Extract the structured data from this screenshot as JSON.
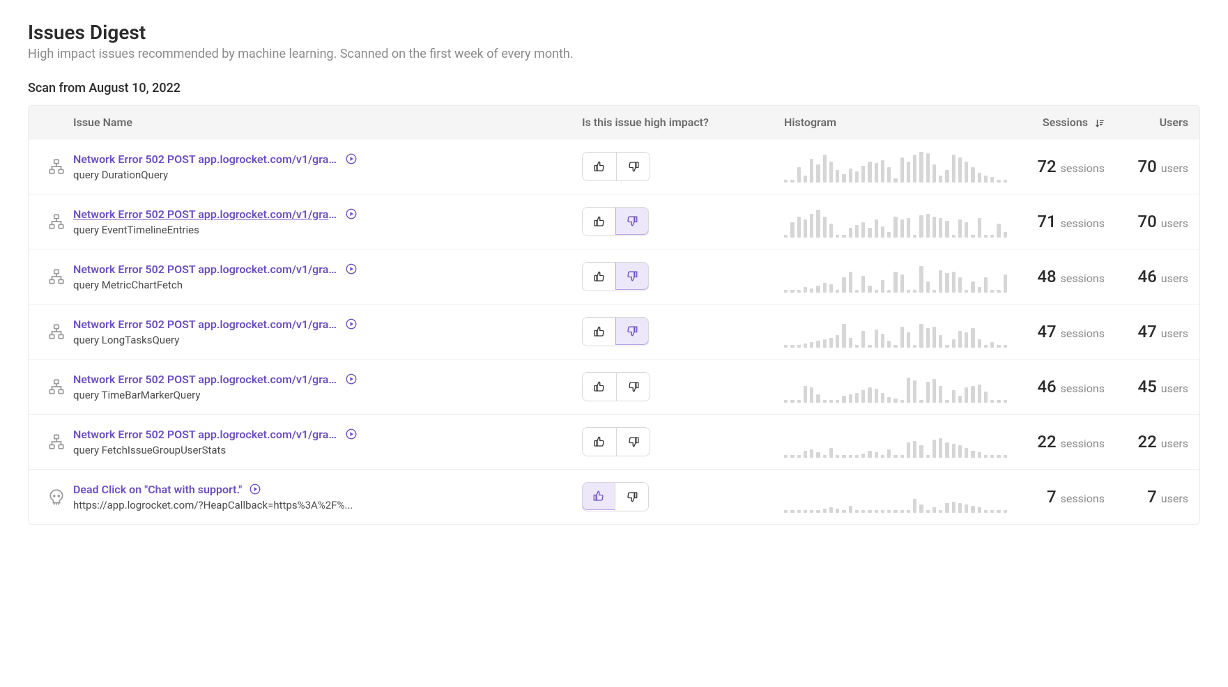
{
  "header": {
    "title": "Issues Digest",
    "subtitle": "High impact issues recommended by machine learning. Scanned on the first week of every month.",
    "scan_line": "Scan from August 10, 2022"
  },
  "columns": {
    "name": "Issue Name",
    "impact": "Is this issue high impact?",
    "histogram": "Histogram",
    "sessions": "Sessions",
    "users": "Users"
  },
  "labels": {
    "sessions_unit": "sessions",
    "users_unit": "users"
  },
  "rows": [
    {
      "icon": "network",
      "title_html": "Network Error 502 POST app.logrocket.com/v1/grap...",
      "underlined": false,
      "subtitle": "query DurationQuery",
      "vote": "none",
      "sessions": 72,
      "users": 70,
      "hist": [
        4,
        4,
        22,
        10,
        34,
        26,
        40,
        30,
        18,
        12,
        20,
        16,
        24,
        30,
        28,
        32,
        22,
        6,
        36,
        30,
        40,
        44,
        42,
        26,
        10,
        18,
        40,
        36,
        30,
        22,
        14,
        10,
        8,
        4,
        4
      ]
    },
    {
      "icon": "network",
      "title_html": "Network Error 502 POST app.logrocket.com/v1/grap...",
      "underlined": true,
      "subtitle": "query EventTimelineEntries",
      "vote": "down",
      "sessions": 71,
      "users": 70,
      "hist": [
        4,
        22,
        30,
        26,
        34,
        40,
        30,
        20,
        4,
        4,
        14,
        18,
        22,
        14,
        26,
        16,
        8,
        30,
        26,
        28,
        4,
        32,
        34,
        30,
        28,
        24,
        4,
        26,
        22,
        4,
        28,
        4,
        4,
        20,
        8
      ]
    },
    {
      "icon": "network",
      "title_html": "Network Error 502 POST app.logrocket.com/v1/grap...",
      "underlined": false,
      "subtitle": "query MetricChartFetch",
      "vote": "down",
      "sessions": 48,
      "users": 46,
      "hist": [
        4,
        4,
        4,
        8,
        6,
        10,
        14,
        12,
        4,
        22,
        30,
        4,
        24,
        10,
        4,
        18,
        4,
        30,
        26,
        4,
        4,
        38,
        16,
        4,
        32,
        28,
        30,
        22,
        4,
        16,
        8,
        22,
        4,
        4,
        26
      ]
    },
    {
      "icon": "network",
      "title_html": "Network Error 502 POST app.logrocket.com/v1/grap...",
      "underlined": false,
      "subtitle": "query LongTasksQuery",
      "vote": "down",
      "sessions": 47,
      "users": 47,
      "hist": [
        4,
        4,
        4,
        6,
        8,
        10,
        12,
        14,
        18,
        34,
        14,
        4,
        24,
        4,
        26,
        20,
        10,
        4,
        30,
        22,
        4,
        34,
        28,
        30,
        18,
        4,
        12,
        24,
        22,
        28,
        12,
        4,
        8,
        4,
        4
      ]
    },
    {
      "icon": "network",
      "title_html": "Network Error 502 POST app.logrocket.com/v1/grap...",
      "underlined": false,
      "subtitle": "query TimeBarMarkerQuery",
      "vote": "none",
      "sessions": 46,
      "users": 45,
      "hist": [
        4,
        4,
        4,
        24,
        22,
        12,
        4,
        4,
        4,
        10,
        12,
        14,
        18,
        22,
        20,
        14,
        8,
        6,
        4,
        36,
        32,
        4,
        30,
        34,
        24,
        4,
        18,
        10,
        22,
        24,
        26,
        16,
        4,
        4,
        4
      ]
    },
    {
      "icon": "network",
      "title_html": "Network Error 502 POST app.logrocket.com/v1/grap...",
      "underlined": false,
      "subtitle": "query FetchIssueGroupUserStats",
      "vote": "none",
      "sessions": 22,
      "users": 22,
      "hist": [
        4,
        4,
        4,
        10,
        12,
        8,
        4,
        14,
        4,
        4,
        4,
        4,
        6,
        10,
        8,
        4,
        12,
        4,
        4,
        22,
        24,
        18,
        4,
        26,
        28,
        22,
        20,
        18,
        14,
        10,
        8,
        4,
        4,
        4,
        4
      ]
    },
    {
      "icon": "dead",
      "title_html": "<span class='highlight'>Dead Click</span> on \"Chat with support.\"",
      "underlined": false,
      "subtitle": "https://app.logrocket.com/?HeapCallback=https%3A%2F%...",
      "vote": "up",
      "sessions": 7,
      "users": 7,
      "hist": [
        4,
        4,
        4,
        4,
        4,
        4,
        6,
        8,
        6,
        4,
        10,
        4,
        4,
        4,
        4,
        4,
        4,
        4,
        4,
        4,
        20,
        12,
        4,
        8,
        4,
        14,
        16,
        14,
        12,
        10,
        8,
        4,
        4,
        4,
        4
      ]
    }
  ]
}
